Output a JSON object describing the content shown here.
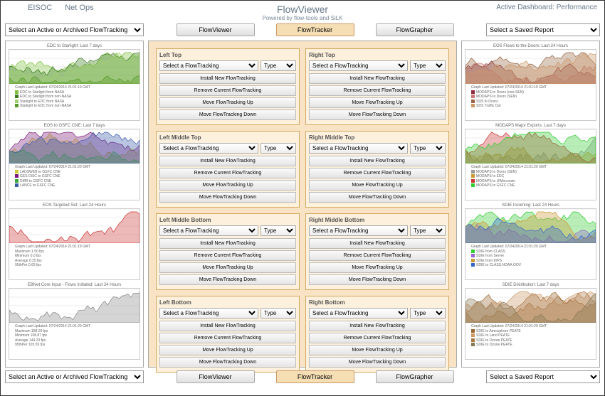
{
  "header": {
    "link1": "EISOC",
    "link2": "Net Ops",
    "title": "FlowViewer",
    "subtitle": "Powered by flow-tools and SiLK",
    "dashboard": "Active Dashboard: Performance"
  },
  "toolbar": {
    "select_left": "Select an Active or Archived FlowTracking",
    "btn_viewer": "FlowViewer",
    "btn_tracker": "FlowTracker",
    "btn_grapher": "FlowGrapher",
    "select_right": "Select a Saved Report"
  },
  "config": {
    "sel_tracking": "Select a FlowTracking",
    "sel_type": "Type",
    "btn_install": "Install New FlowTracking",
    "btn_remove": "Remove Current FlowTracking",
    "btn_up": "Move FlowTracking Up",
    "btn_down": "Move FlowTracking Down",
    "titles_left": [
      "Left Top",
      "Left Middle Top",
      "Left Middle Bottom",
      "Left Bottom"
    ],
    "titles_right": [
      "Right Top",
      "Right Middle Top",
      "Right Middle Bottom",
      "Right Bottom"
    ]
  },
  "graphs_left": [
    {
      "title": "EDC to Starlight: Last 7 days",
      "updated": "Graph Last Updated: 07/24/2014 21:01:19 GMT",
      "legend": [
        "EDC to Starlight from NASA",
        "EDC to Starlight from non-NASA",
        "Starlight to EDC from NASA",
        "Starlight to EDC from non-NASA"
      ],
      "colors": [
        "#7FBF3F",
        "#3a7a1a",
        "#a0d070",
        "#5a9a2a"
      ]
    },
    {
      "title": "EOS to GSFC CNE: Last 7 days",
      "updated": "Graph Last Updated: 07/24/2014 21:01:20 GMT",
      "legend": [
        "LADSWEB to GSFC CNE",
        "GES DISC to GSFC CNE",
        "DMR to GSFC CNE",
        "LANCE to GSFC CNE"
      ],
      "colors": [
        "#cccc33",
        "#7a1a7a",
        "#3aaa3a",
        "#3a5aaa"
      ]
    },
    {
      "title": "EOS Targeted Set: Last 24 Hours",
      "updated": "Graph Last Updated: 07/24/2014 21:01:19 GMT",
      "stats": [
        "Maximum   1.50  fps",
        "Minimum   0.0   fps",
        "Average   0.25  fps",
        "95thPer   0.65  fps"
      ],
      "colors": [
        "#cc3333"
      ]
    },
    {
      "title": "EBNet Core Input - Flows Initiated: Last 24 Hours",
      "updated": "Graph Last Updated: 07/24/2014 21:01:20 GMT",
      "stats": [
        "Maximum   188.00  fps",
        "Minimum   108.87  fps",
        "Average   144.23  fps",
        "95thPer   105.59  fps"
      ],
      "colors": [
        "#888888"
      ]
    }
  ],
  "graphs_right": [
    {
      "title": "EOS Flows to the Doors: Last 24 Hours",
      "updated": "Graph Last Updated: 07/24/2014 21:01:19 GMT",
      "legend": [
        "MODAPS to Doors (non-SEN)",
        "MODAPS to Doors (SEN)",
        "SDS to Doors",
        "SDS Traffic Out"
      ],
      "colors": [
        "#8a2a3a",
        "#cc7777",
        "#996644",
        "#cc9966"
      ]
    },
    {
      "title": "MODAPS Major Exports: Last 7 days",
      "updated": "Graph Last Updated: 07/24/2014 21:01:20 GMT",
      "legend": [
        "MODAPS to Doors (SEN)",
        "MODAPS to EDC",
        "MODAPS to UWisconsin",
        "MODAPS to GSFC CNE"
      ],
      "colors": [
        "#999999",
        "#cc9933",
        "#cc3333",
        "#33cc33"
      ]
    },
    {
      "title": "SDIE Incoming: Last 24 Hours",
      "updated": "Graph Last Updated: 07/24/2014 21:01:20 GMT",
      "legend": [
        "SDIE from CLASS",
        "SDIE from Server",
        "SDIE from IDPS",
        "SDIE to CLASS.NOAA.GOV"
      ],
      "colors": [
        "#33cc33",
        "#9966cc",
        "#cc9933",
        "#3366cc"
      ]
    },
    {
      "title": "SDIE Distribution: Last 7 days",
      "updated": "Graph Last Updated: 07/24/2014 21:01:20 GMT",
      "legend": [
        "SDIE to Atmosphere PEATE",
        "SDIE to Land PEATE",
        "SDIE to Ocean PEATE",
        "SDIE to Ozone PEATE"
      ],
      "colors": [
        "#996633",
        "#cc9966",
        "#aa7744",
        "#887755"
      ]
    }
  ]
}
